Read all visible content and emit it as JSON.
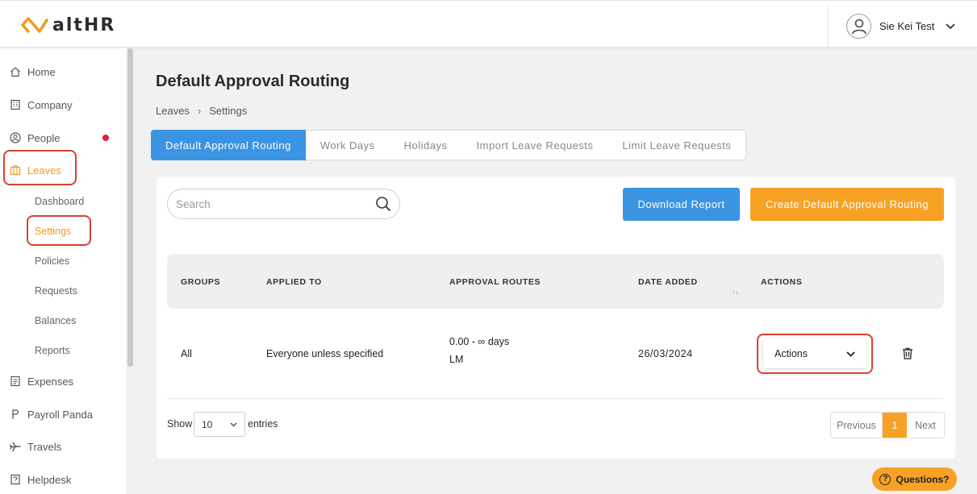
{
  "brand": {
    "name": "altHR",
    "accent": "#f39a1e",
    "primary": "#3a94e2",
    "highlight": "#d8412f"
  },
  "header": {
    "user_name": "Sie Kei Test"
  },
  "sidebar": {
    "items": [
      {
        "label": "Home",
        "icon": "home-icon"
      },
      {
        "label": "Company",
        "icon": "building-icon"
      },
      {
        "label": "People",
        "icon": "person-circle-icon"
      },
      {
        "label": "Leaves",
        "icon": "suitcase-icon"
      },
      {
        "label": "Expenses",
        "icon": "receipt-icon"
      },
      {
        "label": "Payroll Panda",
        "icon": "p-icon"
      },
      {
        "label": "Travels",
        "icon": "plane-icon"
      },
      {
        "label": "Helpdesk",
        "icon": "helpdesk-icon"
      }
    ],
    "leaves_sub": [
      "Dashboard",
      "Settings",
      "Policies",
      "Requests",
      "Balances",
      "Reports"
    ]
  },
  "page": {
    "title": "Default Approval Routing",
    "breadcrumb": [
      "Leaves",
      "Settings"
    ]
  },
  "tabs": [
    "Default Approval Routing",
    "Work Days",
    "Holidays",
    "Import Leave Requests",
    "Limit Leave Requests"
  ],
  "search": {
    "placeholder": "Search"
  },
  "buttons": {
    "download": "Download Report",
    "create": "Create Default Approval Routing"
  },
  "table": {
    "headers": [
      "GROUPS",
      "APPLIED TO",
      "APPROVAL ROUTES",
      "DATE ADDED",
      "ACTIONS"
    ],
    "rows": [
      {
        "group": "All",
        "applied_to": "Everyone unless specified",
        "route_days": "0.00 - ∞ days",
        "route_approver": "LM",
        "date_added": "26/03/2024",
        "actions": "Actions"
      }
    ]
  },
  "footer": {
    "show": "Show",
    "entries_value": "10",
    "entries": "entries",
    "prev": "Previous",
    "page": "1",
    "next": "Next"
  },
  "help": {
    "label": "Questions?"
  }
}
